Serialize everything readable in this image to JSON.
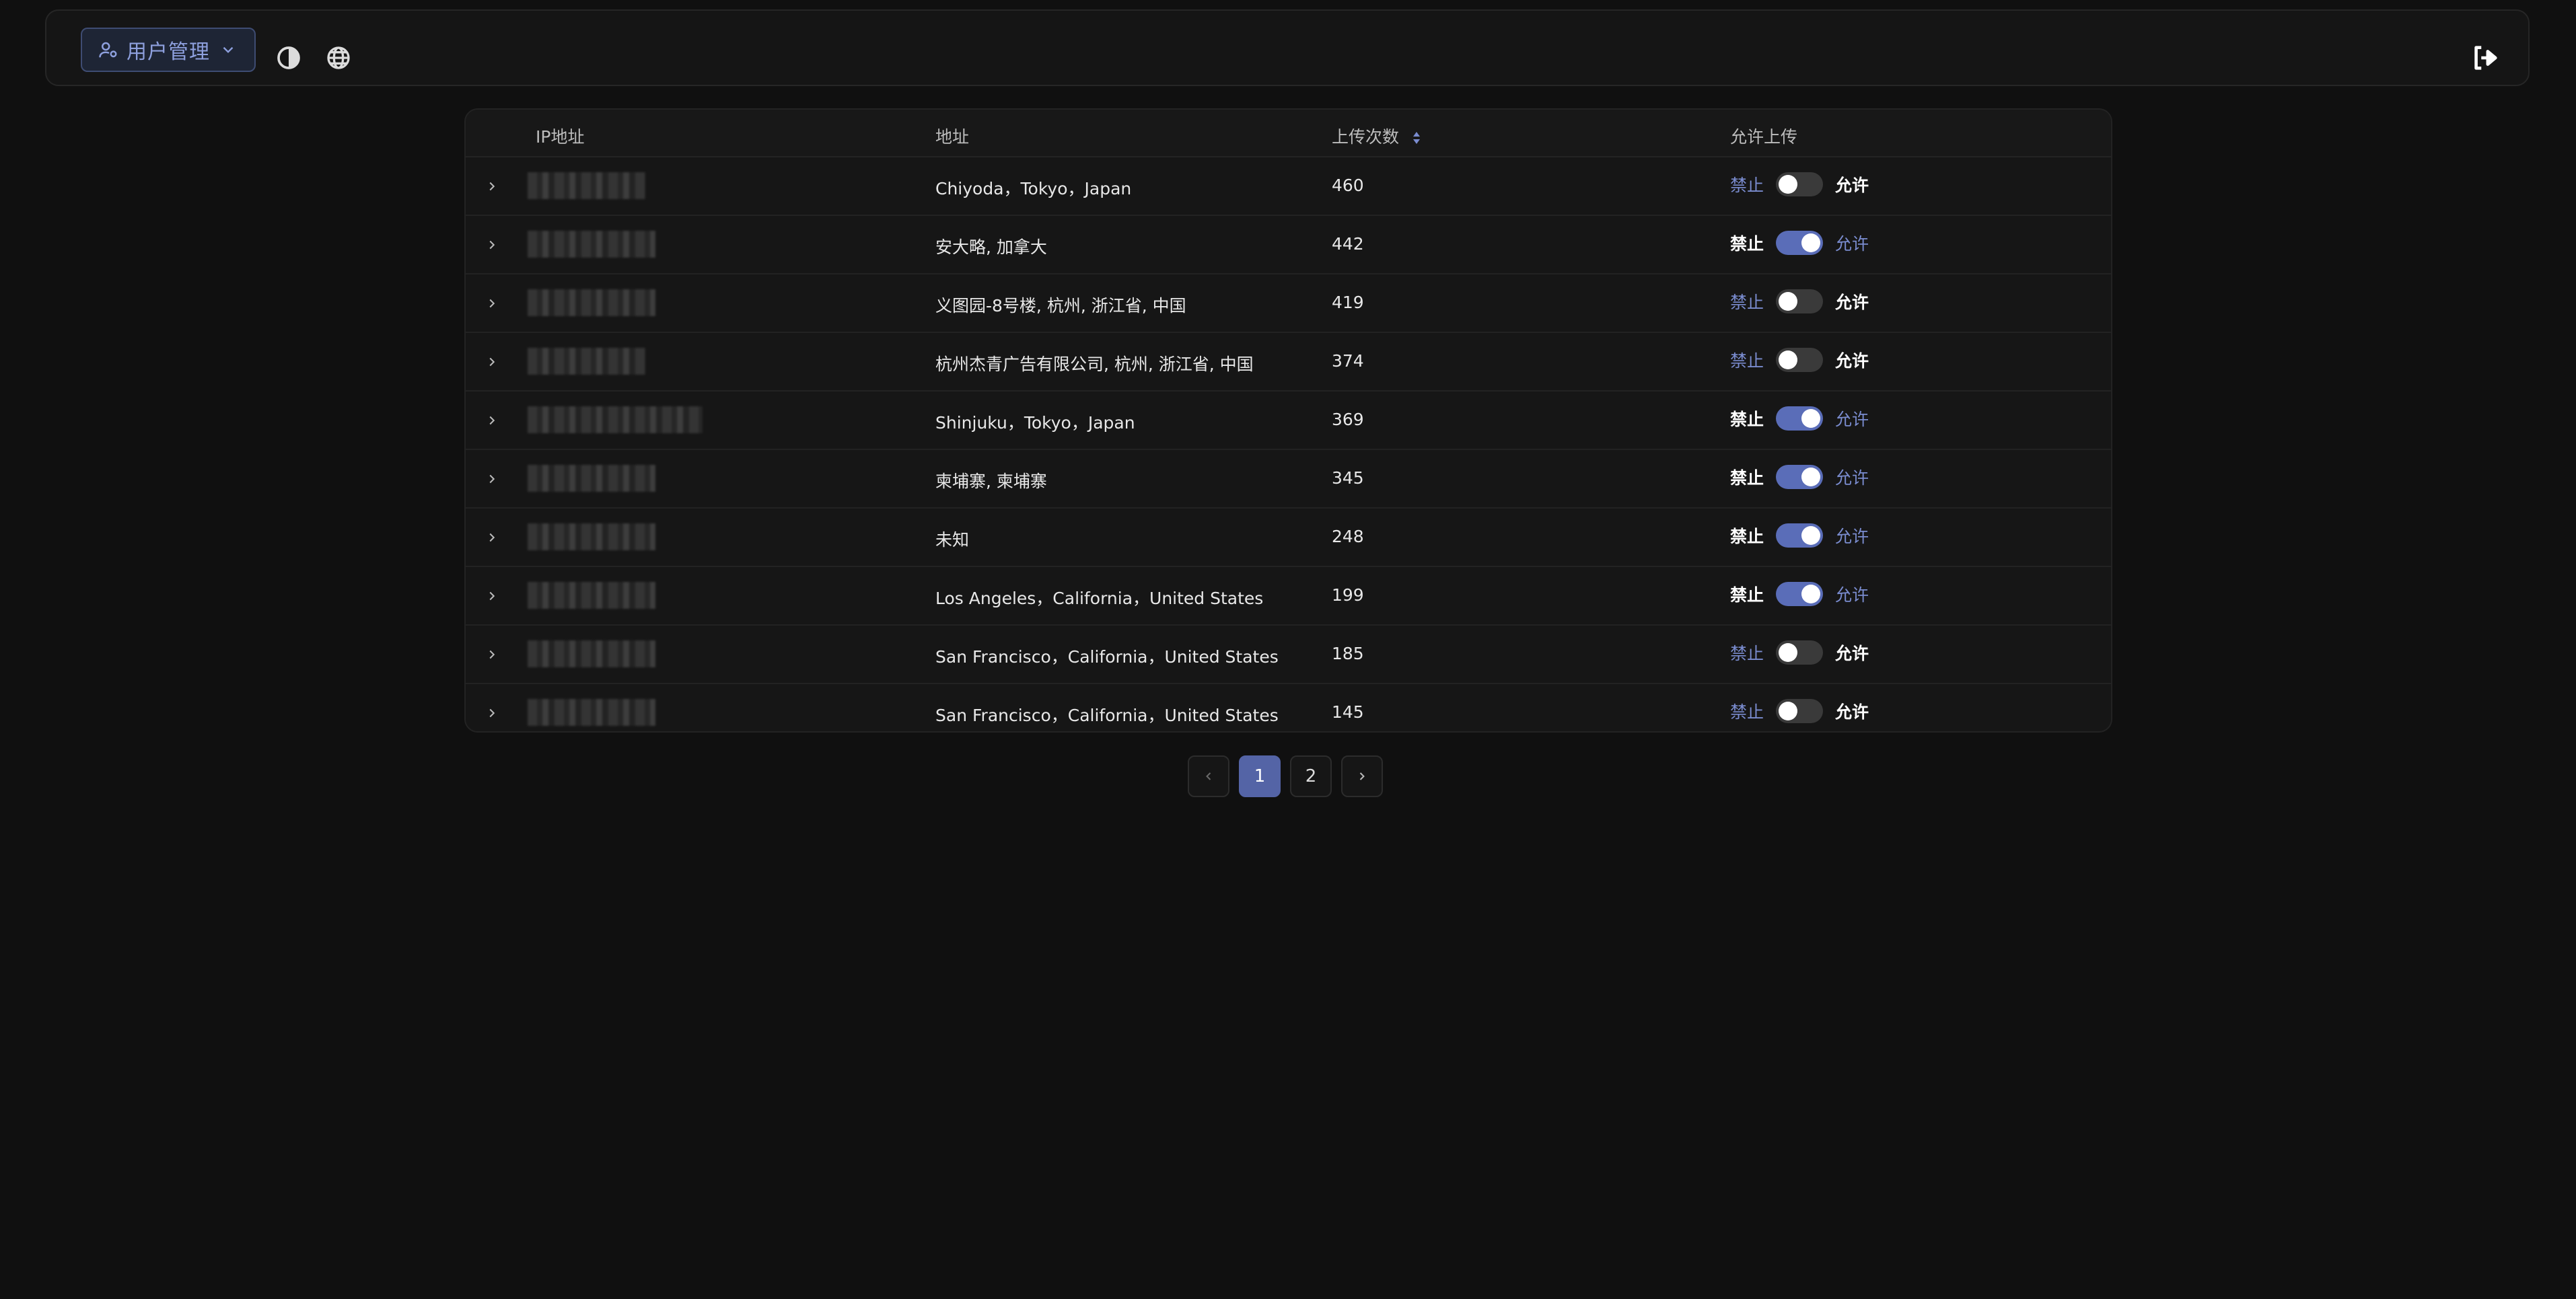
{
  "header": {
    "menu_label": "用户管理",
    "icons": [
      "user-gear-icon",
      "chevron-down-icon",
      "contrast-icon",
      "globe-icon",
      "logout-icon"
    ]
  },
  "table": {
    "columns": {
      "ip": "IP地址",
      "address": "地址",
      "uploads": "上传次数",
      "allow": "允许上传"
    },
    "toggle_labels": {
      "deny": "禁止",
      "allow": "允许"
    },
    "rows": [
      {
        "address": "Chiyoda，Tokyo，Japan",
        "uploads": "460",
        "allowed": true
      },
      {
        "address": "安大略, 加拿大",
        "uploads": "442",
        "allowed": false
      },
      {
        "address": "义图园-8号楼, 杭州, 浙江省, 中国",
        "uploads": "419",
        "allowed": true
      },
      {
        "address": "杭州杰青广告有限公司, 杭州, 浙江省, 中国",
        "uploads": "374",
        "allowed": true
      },
      {
        "address": "Shinjuku，Tokyo，Japan",
        "uploads": "369",
        "allowed": false
      },
      {
        "address": "柬埔寨, 柬埔寨",
        "uploads": "345",
        "allowed": false
      },
      {
        "address": "未知",
        "uploads": "248",
        "allowed": false
      },
      {
        "address": "Los Angeles，California，United States",
        "uploads": "199",
        "allowed": false
      },
      {
        "address": "San Francisco，California，United States",
        "uploads": "185",
        "allowed": true
      },
      {
        "address": "San Francisco，California，United States",
        "uploads": "145",
        "allowed": true
      }
    ]
  },
  "pagination": {
    "pages": [
      "1",
      "2"
    ],
    "current": "1"
  },
  "colors": {
    "accent": "#5464a6",
    "background": "#101010"
  }
}
